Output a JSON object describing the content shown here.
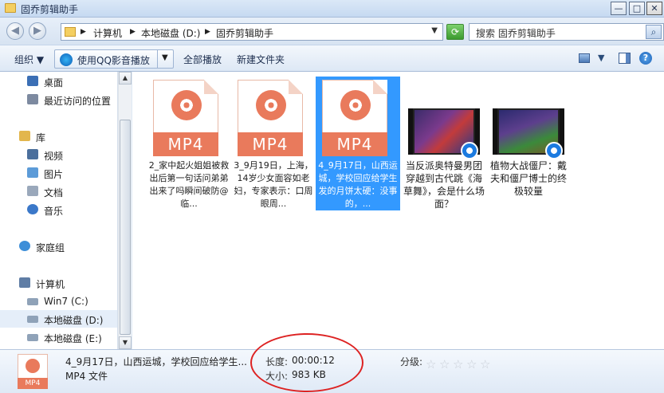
{
  "window": {
    "title": "固乔剪辑助手",
    "controls": {
      "minimize": "—",
      "maximize": "□",
      "close": "✕"
    }
  },
  "addressbar": {
    "back": "◀",
    "forward": "▶",
    "crumbs": [
      "计算机",
      "本地磁盘 (D:)",
      "固乔剪辑助手"
    ],
    "dropdown": "▼",
    "refresh": "⟳",
    "search_placeholder": "搜索 固乔剪辑助手",
    "search_icon": "⌕"
  },
  "toolbar": {
    "organize": "组织 ▼",
    "play_with": "使用QQ影音播放",
    "split_arrow": "▼",
    "play_all": "全部播放",
    "new_folder": "新建文件夹",
    "view_arrow": "▼",
    "help": "?"
  },
  "nav": {
    "items": [
      {
        "label": "桌面",
        "icon": "desktop-icon",
        "color": "#3b6fb5"
      },
      {
        "label": "最近访问的位置",
        "icon": "recent-places-icon",
        "color": "#7d8aa0"
      },
      {
        "label": "库",
        "icon": "libraries-icon",
        "color": "#e2b64d"
      },
      {
        "label": "视频",
        "icon": "videos-icon",
        "color": "#4b6f9c"
      },
      {
        "label": "图片",
        "icon": "pictures-icon",
        "color": "#5c9bd8"
      },
      {
        "label": "文档",
        "icon": "documents-icon",
        "color": "#9aa8bb"
      },
      {
        "label": "音乐",
        "icon": "music-icon",
        "color": "#3b78c9"
      },
      {
        "label": "家庭组",
        "icon": "homegroup-icon",
        "color": "#3d8ed8"
      },
      {
        "label": "计算机",
        "icon": "computer-icon",
        "color": "#5f7da5"
      },
      {
        "label": "Win7 (C:)",
        "icon": "drive-c-icon",
        "color": "#8fa2b8"
      },
      {
        "label": "本地磁盘 (D:)",
        "icon": "drive-d-icon",
        "color": "#8fa2b8"
      },
      {
        "label": "本地磁盘 (E:)",
        "icon": "drive-e-icon",
        "color": "#8fa2b8"
      }
    ],
    "scroll_up": "▲",
    "scroll_down": "▼"
  },
  "files": [
    {
      "name": "2_家中起火姐姐被救出后第一句话问弟弟出来了吗瞬间破防@临...",
      "type": "MP4",
      "selected": false
    },
    {
      "name": "3_9月19日，上海，14岁少女面容如老妇，专家表示：口周眼周...",
      "type": "MP4",
      "selected": false
    },
    {
      "name": "4_9月17日，山西运城，学校回应给学生发的月饼太硬：没事的，...",
      "type": "MP4",
      "selected": true
    },
    {
      "name": "当反派奥特曼男团穿越到古代跳《海草舞》，会是什么场面？",
      "type": "video-thumb",
      "selected": false
    },
    {
      "name": "植物大战僵尸：戴夫和僵尸博士的终极较量",
      "type": "video-thumb",
      "selected": false
    }
  ],
  "details": {
    "icon_label": "MP4",
    "filename": "4_9月17日，山西运城，学校回应给学生...",
    "filetype": "MP4 文件",
    "length_label": "长度:",
    "length_value": "00:00:12",
    "size_label": "大小:",
    "size_value": "983 KB",
    "rating_label": "分级:",
    "rating_stars": "☆"
  }
}
